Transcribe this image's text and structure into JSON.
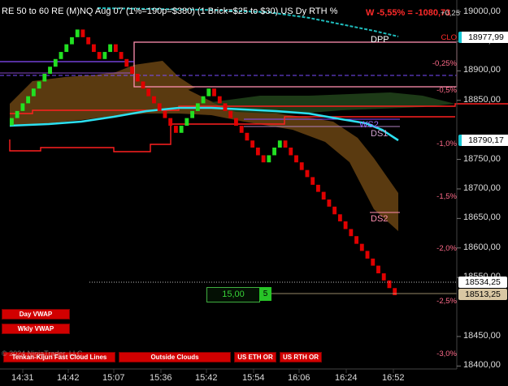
{
  "header": {
    "title": "RE 50 to 60 RE (M)NQ Aug 07 (1%=190p=$380) (1 Brick=$25 to $30)  US Dy RTH %",
    "pnl": "W -5,55% = -1080,73"
  },
  "price_axis": {
    "labels": [
      "19000,00",
      "18950,00",
      "18900,00",
      "18850,00",
      "18750,00",
      "18700,00",
      "18650,00",
      "18600,00",
      "18550,00",
      "18450,00",
      "18400,00"
    ],
    "current_price_boxes": [
      "18977,99",
      "18790,17",
      "18534,25",
      "18513,25"
    ]
  },
  "percent_labels": [
    "+0,25",
    "CLO",
    "-0,25%",
    "-0,5%",
    "-1,0%",
    "-1,5%",
    "-2,0%",
    "-2,5%",
    "-3,0%"
  ],
  "levels": {
    "dpp": "DPP",
    "ws2": "WS2",
    "ds1": "DS1",
    "ds2": "DS2"
  },
  "order_entry": {
    "price": "15,00",
    "qty": "5"
  },
  "buttons": {
    "day_vwap": "Day VWAP",
    "wkly_vwap": "Wkly VWAP",
    "fast_clouds": "Tenkan-Kijun Fast Cloud Lines",
    "outside_clouds": "Outside Clouds",
    "us_eth_or": "US ETH OR",
    "us_rth_or": "US RTH OR"
  },
  "copyright": "© 2024 NinjaTrader, LLC",
  "time_axis": [
    "14:31",
    "14:42",
    "15:07",
    "15:36",
    "15:42",
    "15:54",
    "16:06",
    "16:24",
    "16:52"
  ],
  "colors": {
    "up_brick": "#22e022",
    "down_brick": "#e00000",
    "cloud_brown": "#5a3a10",
    "cloud_green": "#1d3a17",
    "vwap_cyan": "#2ce0f0",
    "dpp_box": "#ff8fb0",
    "purple_line": "#8a4dff",
    "red_line": "#ff2020"
  },
  "chart_data": {
    "type": "renko",
    "title": "RE 50 to 60 RE (M)NQ Aug 07",
    "ylim": [
      18395,
      19020
    ],
    "brick_size": 12.5,
    "bricks_close": [
      18820,
      18832,
      18845,
      18857,
      18870,
      18882,
      18895,
      18907,
      18920,
      18932,
      18945,
      18957,
      18970,
      18957,
      18945,
      18932,
      18920,
      18932,
      18945,
      18932,
      18920,
      18907,
      18895,
      18882,
      18870,
      18857,
      18845,
      18832,
      18820,
      18807,
      18795,
      18807,
      18820,
      18832,
      18845,
      18857,
      18870,
      18857,
      18845,
      18832,
      18820,
      18807,
      18795,
      18782,
      18770,
      18757,
      18745,
      18757,
      18770,
      18782,
      18770,
      18757,
      18745,
      18732,
      18720,
      18707,
      18695,
      18682,
      18670,
      18657,
      18645,
      18632,
      18620,
      18607,
      18595,
      18582,
      18570,
      18557,
      18545,
      18532,
      18520
    ],
    "levels": [
      {
        "name": "DPP",
        "value": 18970
      },
      {
        "name": "WS2",
        "value": 18822
      },
      {
        "name": "DS1",
        "value": 18812
      },
      {
        "name": "DS2",
        "value": 18660
      }
    ],
    "current_price": 18513.25,
    "x_labels": [
      "14:31",
      "14:42",
      "15:07",
      "15:36",
      "15:42",
      "15:54",
      "16:06",
      "16:24",
      "16:52"
    ]
  }
}
